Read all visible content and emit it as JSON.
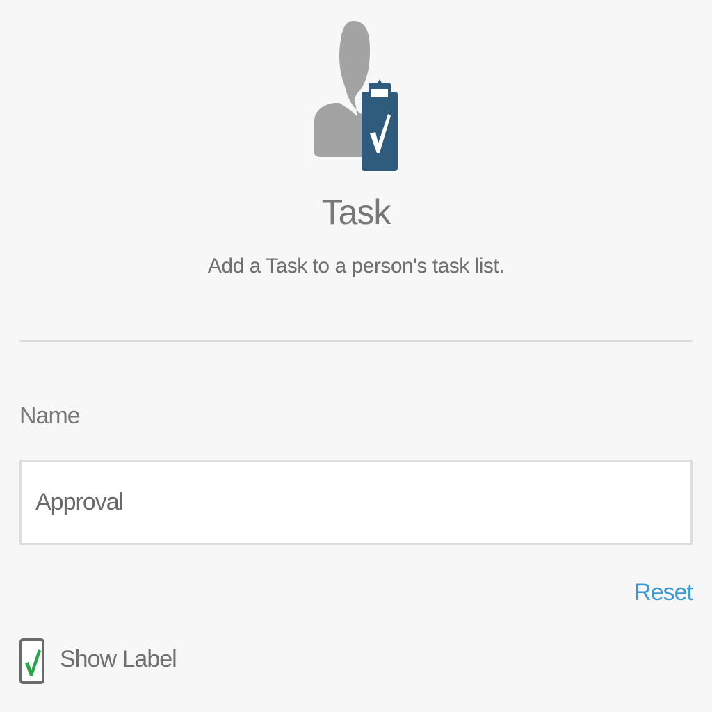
{
  "header": {
    "icon": "task-person-clipboard-icon",
    "title": "Task",
    "description": "Add a Task to a person's task list."
  },
  "form": {
    "name_label": "Name",
    "name_value": "Approval",
    "reset_label": "Reset",
    "show_label": {
      "label": "Show Label",
      "checked": true
    }
  },
  "colors": {
    "clipboard": "#2f5b7c",
    "person": "#a3a3a3",
    "link": "#3a9ad9",
    "check": "#28a745"
  }
}
